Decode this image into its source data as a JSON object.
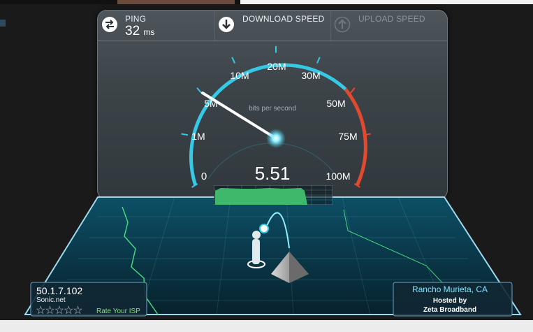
{
  "header": {
    "ping_label": "PING",
    "ping_value": "32",
    "ping_unit": "ms",
    "download_label": "DOWNLOAD SPEED",
    "upload_label": "UPLOAD SPEED"
  },
  "gauge": {
    "ticks": [
      "0",
      "1M",
      "5M",
      "10M",
      "20M",
      "30M",
      "50M",
      "75M",
      "100M"
    ],
    "unit_label": "bits per second",
    "current_value": "5.51",
    "needle_value_mbps": 5.51
  },
  "client": {
    "ip": "50.1.7.102",
    "isp": "Sonic.net",
    "rate_label": "Rate Your ISP",
    "stars_filled": 0,
    "stars_total": 5
  },
  "server": {
    "location": "Rancho Murieta, CA",
    "hosted_label": "Hosted by",
    "host_name": "Zeta Broadband"
  },
  "colors": {
    "accent_cyan": "#35c9e6",
    "high_range_red": "#e24a2f",
    "graph_green": "#3fb86c",
    "rate_green": "#7fe07a"
  }
}
